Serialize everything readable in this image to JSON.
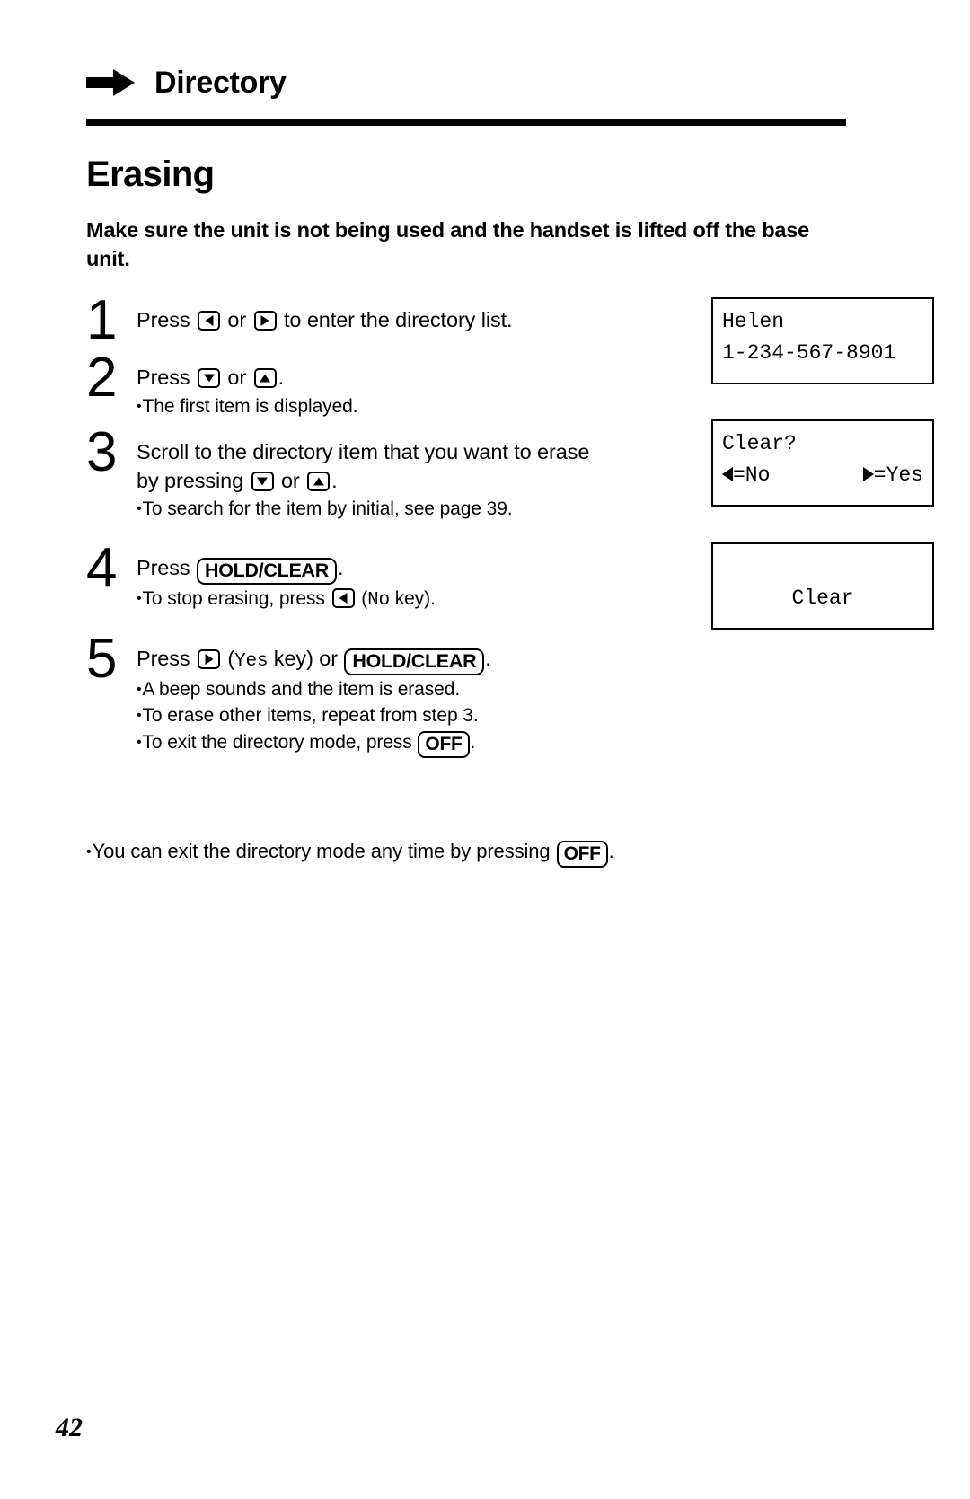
{
  "header": {
    "icon": "right-arrow-icon",
    "title": "Directory"
  },
  "section": {
    "title": "Erasing",
    "lead": "Make sure the unit is not being used and the handset is lifted off the base unit."
  },
  "steps": [
    {
      "number": "1",
      "main_pre": "Press ",
      "key_a": "left-arrow-key",
      "main_mid": " or ",
      "key_b": "right-arrow-key",
      "main_post": " to enter the directory list.",
      "subs": []
    },
    {
      "number": "2",
      "main_pre": "Press ",
      "key_a": "down-arrow-key",
      "main_mid": " or ",
      "key_b": "up-arrow-key",
      "main_post": ".",
      "subs": [
        "The first item is displayed."
      ]
    },
    {
      "number": "3",
      "main_pre": "Scroll to the directory item that you want to erase by pressing ",
      "key_a": "down-arrow-key",
      "main_mid": " or ",
      "key_b": "up-arrow-key",
      "main_post": ".",
      "subs": [
        "To search for the item by initial, see page 39."
      ]
    },
    {
      "number": "4",
      "main_pre": "Press ",
      "button": "HOLD/CLEAR",
      "main_post": ".",
      "sub_pre": "To stop erasing, press ",
      "sub_key": "left-arrow-key",
      "sub_mid": " (",
      "sub_mono": "No",
      "sub_post": " key)."
    },
    {
      "number": "5",
      "main_pre": "Press ",
      "key_a": "right-arrow-key",
      "main_mid_open": " (",
      "main_mono": "Yes",
      "main_mid_close": " key) or ",
      "button": "HOLD/CLEAR",
      "main_post": ".",
      "subs": [
        "A beep sounds and the item is erased.",
        "To erase other items, repeat from step 3."
      ],
      "last_sub_pre": "To exit the directory mode, press ",
      "last_sub_button": "OFF",
      "last_sub_post": "."
    }
  ],
  "displays": [
    {
      "id": "lcd-1",
      "line1": "Helen",
      "line2": "1-234-567-8901"
    },
    {
      "id": "lcd-2",
      "line1": "Clear?",
      "left_label": "=No",
      "right_label": "=Yes"
    },
    {
      "id": "lcd-3",
      "line1": "",
      "line2": "Clear"
    }
  ],
  "footnote": {
    "pre": "You can exit the directory mode any time by pressing ",
    "button": "OFF",
    "post": "."
  },
  "page_number": "42",
  "colors": {
    "ink": "#000000",
    "paper": "#ffffff"
  }
}
